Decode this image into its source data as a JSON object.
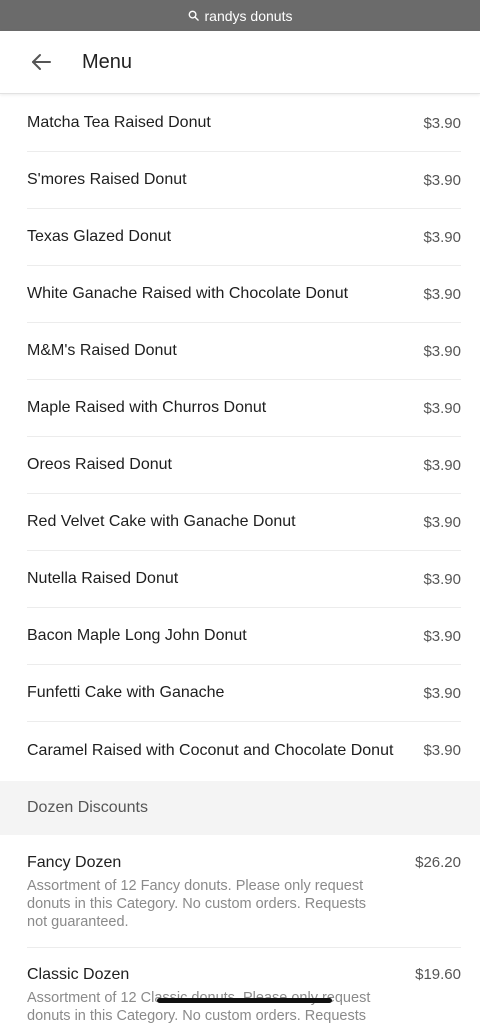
{
  "browser": {
    "url_text": "randys donuts"
  },
  "header": {
    "title": "Menu"
  },
  "menu_items": [
    {
      "name": "Matcha Tea Raised Donut",
      "price": "$3.90"
    },
    {
      "name": "S'mores Raised Donut",
      "price": "$3.90"
    },
    {
      "name": "Texas Glazed Donut",
      "price": "$3.90"
    },
    {
      "name": "White Ganache Raised with Chocolate Donut",
      "price": "$3.90"
    },
    {
      "name": "M&M's Raised Donut",
      "price": "$3.90"
    },
    {
      "name": "Maple Raised with Churros Donut",
      "price": "$3.90"
    },
    {
      "name": "Oreos Raised Donut",
      "price": "$3.90"
    },
    {
      "name": "Red Velvet Cake with Ganache Donut",
      "price": "$3.90"
    },
    {
      "name": "Nutella Raised Donut",
      "price": "$3.90"
    },
    {
      "name": "Bacon Maple Long John Donut",
      "price": "$3.90"
    },
    {
      "name": "Funfetti Cake with Ganache",
      "price": "$3.90"
    },
    {
      "name": "Caramel Raised with Coconut and Chocolate Donut",
      "price": "$3.90"
    }
  ],
  "section": {
    "title": "Dozen Discounts"
  },
  "dozen_items": [
    {
      "name": "Fancy Dozen",
      "price": "$26.20",
      "description": "Assortment of 12 Fancy donuts. Please only request donuts in this Category. No custom orders. Requests not guaranteed."
    },
    {
      "name": "Classic Dozen",
      "price": "$19.60",
      "description": "Assortment of 12 Classic donuts. Please only request donuts in this Category. No custom orders. Requests"
    }
  ]
}
